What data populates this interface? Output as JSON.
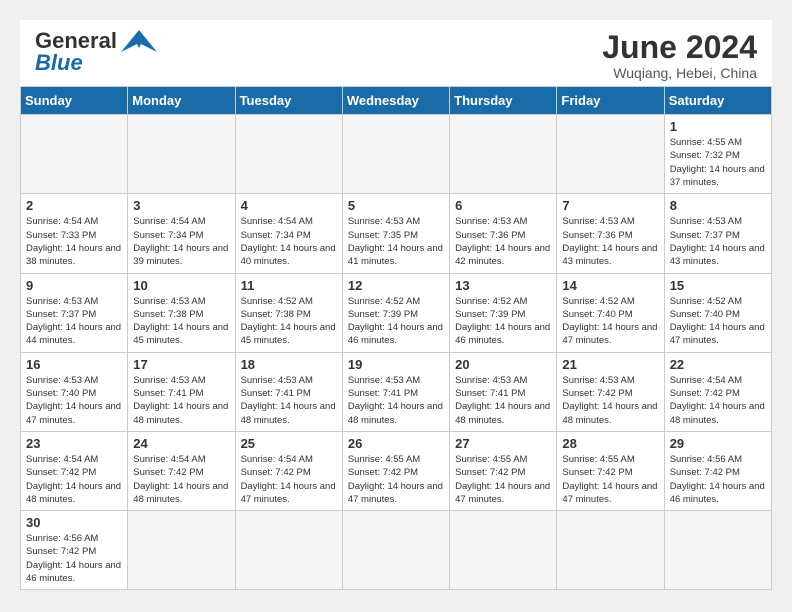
{
  "logo": {
    "general": "General",
    "blue": "Blue"
  },
  "title": "June 2024",
  "location": "Wuqiang, Hebei, China",
  "weekdays": [
    "Sunday",
    "Monday",
    "Tuesday",
    "Wednesday",
    "Thursday",
    "Friday",
    "Saturday"
  ],
  "weeks": [
    [
      {
        "day": "",
        "info": ""
      },
      {
        "day": "",
        "info": ""
      },
      {
        "day": "",
        "info": ""
      },
      {
        "day": "",
        "info": ""
      },
      {
        "day": "",
        "info": ""
      },
      {
        "day": "",
        "info": ""
      },
      {
        "day": "1",
        "info": "Sunrise: 4:55 AM\nSunset: 7:32 PM\nDaylight: 14 hours and 37 minutes."
      }
    ],
    [
      {
        "day": "2",
        "info": "Sunrise: 4:54 AM\nSunset: 7:33 PM\nDaylight: 14 hours and 38 minutes."
      },
      {
        "day": "3",
        "info": "Sunrise: 4:54 AM\nSunset: 7:34 PM\nDaylight: 14 hours and 39 minutes."
      },
      {
        "day": "4",
        "info": "Sunrise: 4:54 AM\nSunset: 7:34 PM\nDaylight: 14 hours and 40 minutes."
      },
      {
        "day": "5",
        "info": "Sunrise: 4:53 AM\nSunset: 7:35 PM\nDaylight: 14 hours and 41 minutes."
      },
      {
        "day": "6",
        "info": "Sunrise: 4:53 AM\nSunset: 7:36 PM\nDaylight: 14 hours and 42 minutes."
      },
      {
        "day": "7",
        "info": "Sunrise: 4:53 AM\nSunset: 7:36 PM\nDaylight: 14 hours and 43 minutes."
      },
      {
        "day": "8",
        "info": "Sunrise: 4:53 AM\nSunset: 7:37 PM\nDaylight: 14 hours and 43 minutes."
      }
    ],
    [
      {
        "day": "9",
        "info": "Sunrise: 4:53 AM\nSunset: 7:37 PM\nDaylight: 14 hours and 44 minutes."
      },
      {
        "day": "10",
        "info": "Sunrise: 4:53 AM\nSunset: 7:38 PM\nDaylight: 14 hours and 45 minutes."
      },
      {
        "day": "11",
        "info": "Sunrise: 4:52 AM\nSunset: 7:38 PM\nDaylight: 14 hours and 45 minutes."
      },
      {
        "day": "12",
        "info": "Sunrise: 4:52 AM\nSunset: 7:39 PM\nDaylight: 14 hours and 46 minutes."
      },
      {
        "day": "13",
        "info": "Sunrise: 4:52 AM\nSunset: 7:39 PM\nDaylight: 14 hours and 46 minutes."
      },
      {
        "day": "14",
        "info": "Sunrise: 4:52 AM\nSunset: 7:40 PM\nDaylight: 14 hours and 47 minutes."
      },
      {
        "day": "15",
        "info": "Sunrise: 4:52 AM\nSunset: 7:40 PM\nDaylight: 14 hours and 47 minutes."
      }
    ],
    [
      {
        "day": "16",
        "info": "Sunrise: 4:53 AM\nSunset: 7:40 PM\nDaylight: 14 hours and 47 minutes."
      },
      {
        "day": "17",
        "info": "Sunrise: 4:53 AM\nSunset: 7:41 PM\nDaylight: 14 hours and 48 minutes."
      },
      {
        "day": "18",
        "info": "Sunrise: 4:53 AM\nSunset: 7:41 PM\nDaylight: 14 hours and 48 minutes."
      },
      {
        "day": "19",
        "info": "Sunrise: 4:53 AM\nSunset: 7:41 PM\nDaylight: 14 hours and 48 minutes."
      },
      {
        "day": "20",
        "info": "Sunrise: 4:53 AM\nSunset: 7:41 PM\nDaylight: 14 hours and 48 minutes."
      },
      {
        "day": "21",
        "info": "Sunrise: 4:53 AM\nSunset: 7:42 PM\nDaylight: 14 hours and 48 minutes."
      },
      {
        "day": "22",
        "info": "Sunrise: 4:54 AM\nSunset: 7:42 PM\nDaylight: 14 hours and 48 minutes."
      }
    ],
    [
      {
        "day": "23",
        "info": "Sunrise: 4:54 AM\nSunset: 7:42 PM\nDaylight: 14 hours and 48 minutes."
      },
      {
        "day": "24",
        "info": "Sunrise: 4:54 AM\nSunset: 7:42 PM\nDaylight: 14 hours and 48 minutes."
      },
      {
        "day": "25",
        "info": "Sunrise: 4:54 AM\nSunset: 7:42 PM\nDaylight: 14 hours and 47 minutes."
      },
      {
        "day": "26",
        "info": "Sunrise: 4:55 AM\nSunset: 7:42 PM\nDaylight: 14 hours and 47 minutes."
      },
      {
        "day": "27",
        "info": "Sunrise: 4:55 AM\nSunset: 7:42 PM\nDaylight: 14 hours and 47 minutes."
      },
      {
        "day": "28",
        "info": "Sunrise: 4:55 AM\nSunset: 7:42 PM\nDaylight: 14 hours and 47 minutes."
      },
      {
        "day": "29",
        "info": "Sunrise: 4:56 AM\nSunset: 7:42 PM\nDaylight: 14 hours and 46 minutes."
      }
    ],
    [
      {
        "day": "30",
        "info": "Sunrise: 4:56 AM\nSunset: 7:42 PM\nDaylight: 14 hours and 46 minutes."
      },
      {
        "day": "",
        "info": ""
      },
      {
        "day": "",
        "info": ""
      },
      {
        "day": "",
        "info": ""
      },
      {
        "day": "",
        "info": ""
      },
      {
        "day": "",
        "info": ""
      },
      {
        "day": "",
        "info": ""
      }
    ]
  ]
}
